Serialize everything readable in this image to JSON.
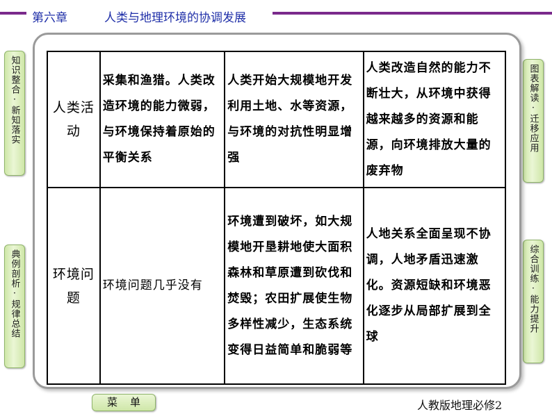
{
  "header": {
    "chapter": "第六章",
    "title": "人类与地理环境的协调发展",
    "accent_color": "#7a2a8c",
    "text_color": "#1f2fa8"
  },
  "nav": {
    "left": [
      {
        "label": "知识整合·新知落实"
      },
      {
        "label": "典例剖析·规律总结"
      }
    ],
    "right": [
      {
        "label": "图表解读·迁移应用"
      },
      {
        "label": "综合训练·能力提升"
      }
    ]
  },
  "table": {
    "rows": [
      {
        "header": "人类活动",
        "cells": [
          "采集和渔猎。人类改造环境的能力微弱，与环境保持着原始的平衡关系",
          "人类开始大规模地开发利用土地、水等资源，与环境的对抗性明显增强",
          "人类改造自然的能力不断壮大，从环境中获得越来越多的资源和能源，向环境排放大量的废弃物"
        ]
      },
      {
        "header": "环境问题",
        "cells": [
          "环境问题几乎没有",
          "环境遭到破坏，如大规模地开垦耕地使大面积森林和草原遭到砍伐和焚毁；农田扩展使生物多样性减少，生态系统变得日益简单和脆弱等",
          "人地关系全面呈现不协调，人地矛盾迅速激化。资源短缺和环境恶化逐步从局部扩展到全球"
        ]
      }
    ]
  },
  "footer": {
    "menu_label": "菜单",
    "book": "人教版地理必修2"
  }
}
